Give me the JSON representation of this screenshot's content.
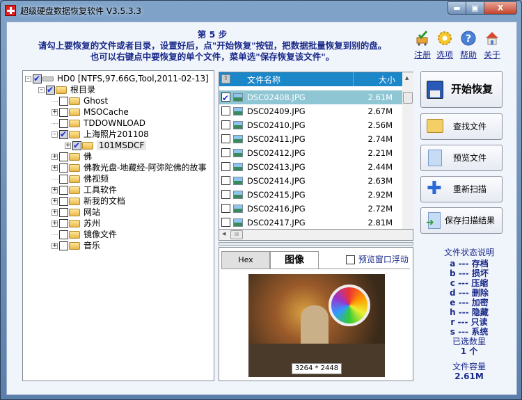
{
  "window": {
    "title": "超级硬盘数据恢复软件 V3.5.3.3",
    "min": "▬",
    "max": "▣",
    "close": "X"
  },
  "header": {
    "step": "第 5 步",
    "line1": "请勾上要恢复的文件或者目录，设置好后，点\"开始恢复\"按钮，把数据批量恢复到别的盘。",
    "line2": "也可以右键点中要恢复的单个文件，菜单选\"保存恢复该文件\"。"
  },
  "toolbar": [
    {
      "label": "注册",
      "icon": "cart-check-icon"
    },
    {
      "label": "选项",
      "icon": "gear-icon"
    },
    {
      "label": "帮助",
      "icon": "help-icon"
    },
    {
      "label": "关于",
      "icon": "home-icon"
    }
  ],
  "tree": [
    {
      "label": "HD0  [NTFS,97.66G,Tool,2011-02-13]",
      "level": 0,
      "exp": "-",
      "checked": true,
      "type": "disk"
    },
    {
      "label": "根目录",
      "level": 1,
      "exp": "-",
      "checked": true
    },
    {
      "label": "Ghost",
      "level": 2,
      "exp": "",
      "checked": false
    },
    {
      "label": "MSOCache",
      "level": 2,
      "exp": "+",
      "checked": false
    },
    {
      "label": "TDDOWNLOAD",
      "level": 2,
      "exp": "",
      "checked": false
    },
    {
      "label": "上海照片201108",
      "level": 2,
      "exp": "-",
      "checked": true
    },
    {
      "label": "101MSDCF",
      "level": 3,
      "exp": "+",
      "checked": true,
      "selected": true
    },
    {
      "label": "佛",
      "level": 2,
      "exp": "+",
      "checked": false
    },
    {
      "label": "佛教光盘-地藏经-阿弥陀佛的故事",
      "level": 2,
      "exp": "+",
      "checked": false
    },
    {
      "label": "佛视频",
      "level": 2,
      "exp": "",
      "checked": false
    },
    {
      "label": "工具软件",
      "level": 2,
      "exp": "+",
      "checked": false
    },
    {
      "label": "新我的文档",
      "level": 2,
      "exp": "+",
      "checked": false
    },
    {
      "label": "网站",
      "level": 2,
      "exp": "+",
      "checked": false
    },
    {
      "label": "苏州",
      "level": 2,
      "exp": "+",
      "checked": false
    },
    {
      "label": "镜像文件",
      "level": 2,
      "exp": "",
      "checked": false
    },
    {
      "label": "音乐",
      "level": 2,
      "exp": "+",
      "checked": false
    }
  ],
  "filelist": {
    "col_name": "文件名称",
    "col_size": "大小",
    "rows": [
      {
        "name": "DSC02408.JPG",
        "size": "2.61M",
        "checked": true,
        "selected": true
      },
      {
        "name": "DSC02409.JPG",
        "size": "2.67M",
        "checked": false
      },
      {
        "name": "DSC02410.JPG",
        "size": "2.56M",
        "checked": false
      },
      {
        "name": "DSC02411.JPG",
        "size": "2.74M",
        "checked": false
      },
      {
        "name": "DSC02412.JPG",
        "size": "2.21M",
        "checked": false
      },
      {
        "name": "DSC02413.JPG",
        "size": "2.44M",
        "checked": false
      },
      {
        "name": "DSC02414.JPG",
        "size": "2.63M",
        "checked": false
      },
      {
        "name": "DSC02415.JPG",
        "size": "2.92M",
        "checked": false
      },
      {
        "name": "DSC02416.JPG",
        "size": "2.72M",
        "checked": false
      },
      {
        "name": "DSC02417.JPG",
        "size": "2.81M",
        "checked": false
      }
    ]
  },
  "preview": {
    "tab_hex": "Hex",
    "tab_image": "图像",
    "float_label": "预览窗口浮动",
    "float_checked": false,
    "dimensions": "3264 * 2448"
  },
  "buttons": {
    "start": "开始恢复",
    "find": "查找文件",
    "preview": "预览文件",
    "rescan": "重新扫描",
    "save_scan": "保存扫描结果"
  },
  "legend": {
    "title": "文件状态说明",
    "items": [
      "a --- 存档",
      "b --- 损坏",
      "c --- 压缩",
      "d --- 删除",
      "e --- 加密",
      "h --- 隐藏",
      "r --- 只读",
      "s --- 系统"
    ],
    "selected_label": "已选数里",
    "selected_value": "1 个",
    "size_label": "文件容量",
    "size_value": "2.61M"
  }
}
